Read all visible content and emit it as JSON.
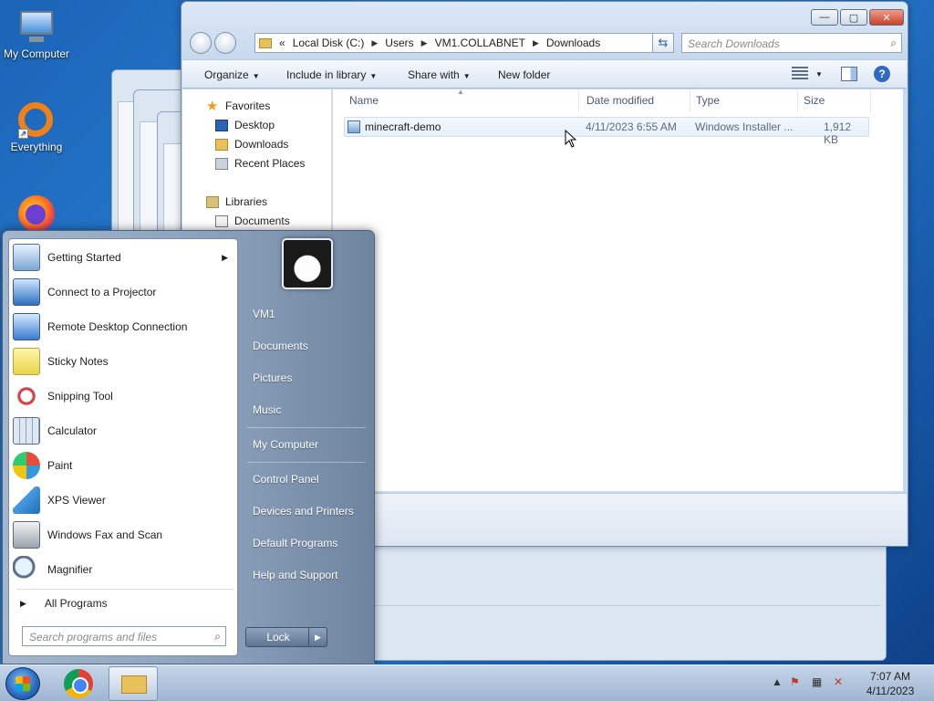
{
  "desktop": {
    "icons": [
      {
        "label": "My Computer"
      },
      {
        "label": "Everything"
      },
      {
        "label": ""
      }
    ]
  },
  "explorer": {
    "window_buttons": {
      "minimize": "—",
      "maximize": "▢",
      "close": "✕"
    },
    "address": {
      "overflow": "«",
      "segments": [
        "Local Disk (C:)",
        "Users",
        "VM1.COLLABNET",
        "Downloads"
      ]
    },
    "search_placeholder": "Search Downloads",
    "toolbar": {
      "organize": "Organize",
      "include_in_library": "Include in library",
      "share_with": "Share with",
      "new_folder": "New folder"
    },
    "nav": {
      "favorites": "Favorites",
      "desktop": "Desktop",
      "downloads": "Downloads",
      "recent_places": "Recent Places",
      "libraries": "Libraries",
      "documents": "Documents"
    },
    "columns": [
      "Name",
      "Date modified",
      "Type",
      "Size"
    ],
    "files": [
      {
        "name": "minecraft-demo",
        "date_modified": "4/11/2023 6:55 AM",
        "type": "Windows Installer ...",
        "size": "1,912 KB"
      }
    ]
  },
  "start_menu": {
    "programs": [
      {
        "label": "Getting Started",
        "submenu": true
      },
      {
        "label": "Connect to a Projector"
      },
      {
        "label": "Remote Desktop Connection"
      },
      {
        "label": "Sticky Notes"
      },
      {
        "label": "Snipping Tool"
      },
      {
        "label": "Calculator"
      },
      {
        "label": "Paint"
      },
      {
        "label": "XPS Viewer"
      },
      {
        "label": "Windows Fax and Scan"
      },
      {
        "label": "Magnifier"
      }
    ],
    "all_programs": "All Programs",
    "search_placeholder": "Search programs and files",
    "right_items": [
      "VM1",
      "Documents",
      "Pictures",
      "Music",
      "My Computer",
      "Control Panel",
      "Devices and Printers",
      "Default Programs",
      "Help and Support"
    ],
    "lock_label": "Lock"
  },
  "taskbar": {
    "time": "7:07 AM",
    "date": "4/11/2023"
  }
}
